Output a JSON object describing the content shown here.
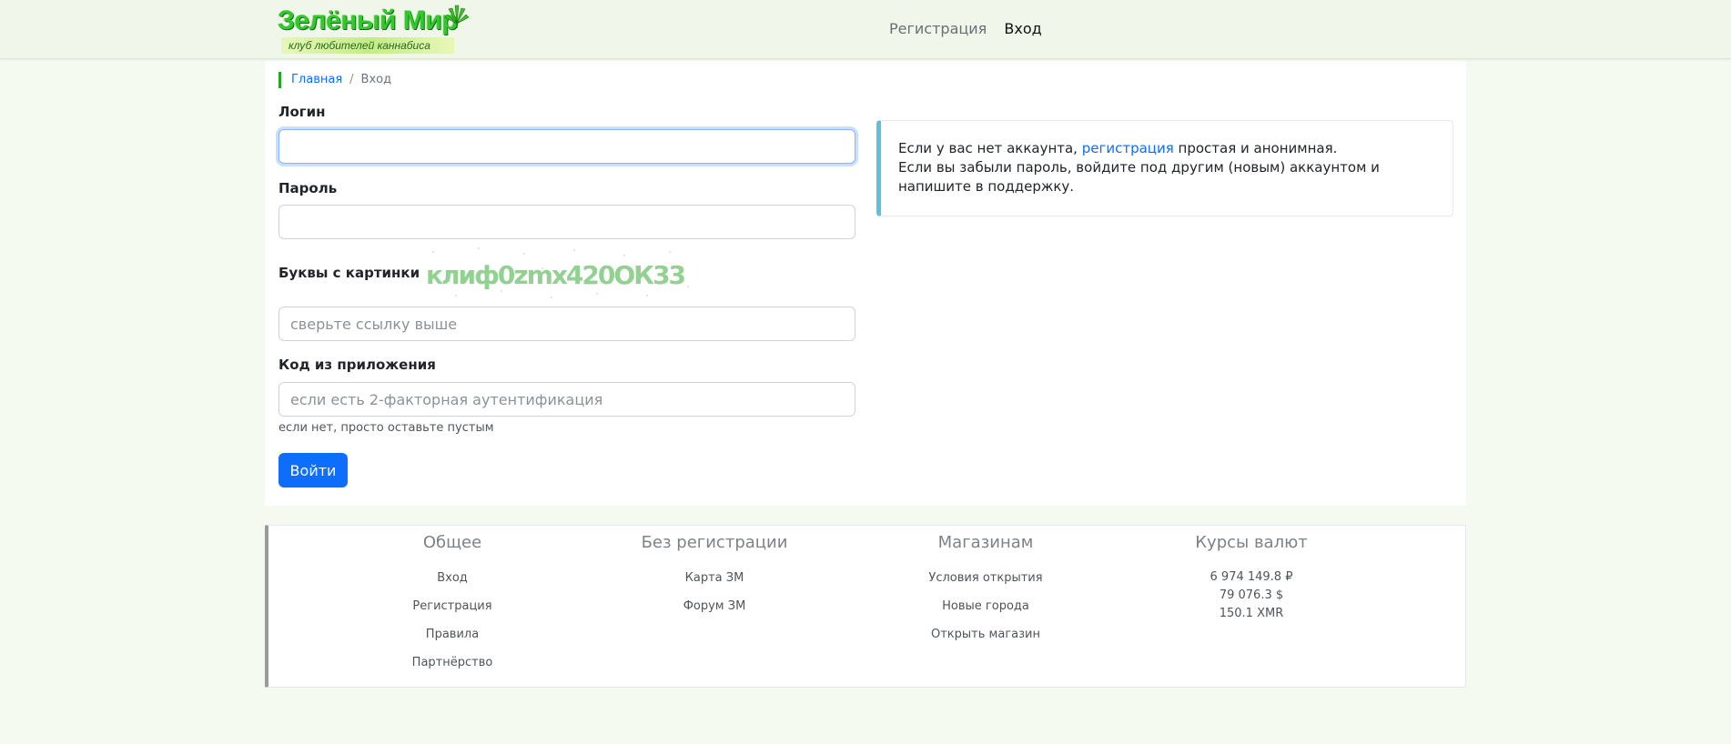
{
  "header": {
    "logo_title": "Зелёный Мир",
    "logo_subtitle": "клуб любителей каннабиса",
    "nav": [
      {
        "label": "Регистрация",
        "active": false
      },
      {
        "label": "Вход",
        "active": true
      }
    ]
  },
  "breadcrumb": {
    "home": "Главная",
    "current": "Вход"
  },
  "form": {
    "login_label": "Логин",
    "login_value": "",
    "password_label": "Пароль",
    "password_value": "",
    "captcha_label": "Буквы с картинки",
    "captcha_text": "клиф0zmx420ОК33",
    "captcha_placeholder": "сверьте ссылку выше",
    "code_label": "Код из приложения",
    "code_placeholder": "если есть 2-факторная аутентификация",
    "code_help": "если нет, просто оставьте пустым",
    "submit_label": "Войти"
  },
  "info": {
    "line1_before": "Если у вас нет аккаунта, ",
    "line1_link": "регистрация",
    "line1_after": " простая и анонимная.",
    "line2": "Если вы забыли пароль, войдите под другим (новым) аккаунтом и напишите в поддержку."
  },
  "footer": {
    "general": {
      "title": "Общее",
      "links": [
        "Вход",
        "Регистрация",
        "Правила",
        "Партнёрство"
      ]
    },
    "no_reg": {
      "title": "Без регистрации",
      "links": [
        "Карта ЗМ",
        "Форум ЗМ"
      ]
    },
    "shops": {
      "title": "Магазинам",
      "links": [
        "Условия открытия",
        "Новые города",
        "Открыть магазин"
      ]
    },
    "rates": {
      "title": "Курсы валют",
      "values": [
        "6 974 149.8 ₽",
        "79 076.3 $",
        "150.1 XMR"
      ]
    }
  },
  "colors": {
    "primary": "#0d6efd",
    "brand_green": "#34c72f",
    "info_border": "#5bc0de",
    "page_bg": "#f5faf0"
  }
}
